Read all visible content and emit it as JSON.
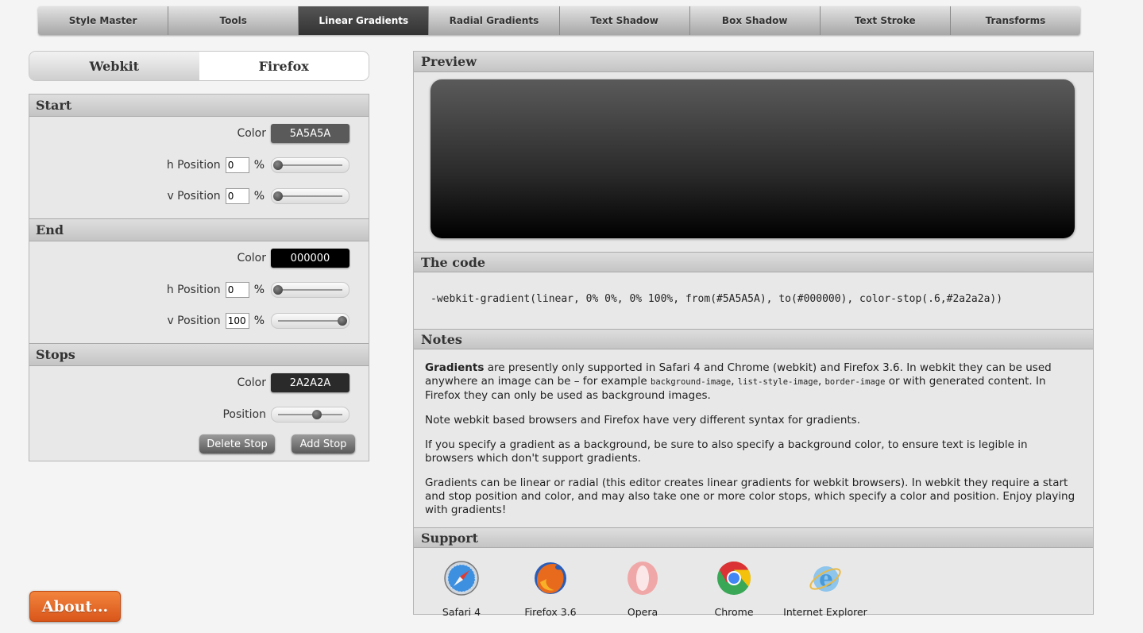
{
  "nav": {
    "tabs": [
      {
        "label": "Style Master",
        "active": false
      },
      {
        "label": "Tools",
        "active": false
      },
      {
        "label": "Linear Gradients",
        "active": true
      },
      {
        "label": "Radial Gradients",
        "active": false
      },
      {
        "label": "Text Shadow",
        "active": false
      },
      {
        "label": "Box Shadow",
        "active": false
      },
      {
        "label": "Text Stroke",
        "active": false
      },
      {
        "label": "Transforms",
        "active": false
      }
    ]
  },
  "browser_toggle": {
    "webkit": "Webkit",
    "firefox": "Firefox",
    "selected": "Firefox"
  },
  "start": {
    "title": "Start",
    "color_label": "Color",
    "color_value": "5A5A5A",
    "color_hex": "#5A5A5A",
    "h_label": "h Position",
    "h_value": "0",
    "h_unit": "%",
    "h_percent": 0,
    "v_label": "v Position",
    "v_value": "0",
    "v_unit": "%",
    "v_percent": 0
  },
  "end": {
    "title": "End",
    "color_label": "Color",
    "color_value": "000000",
    "color_hex": "#000000",
    "h_label": "h Position",
    "h_value": "0",
    "h_unit": "%",
    "h_percent": 0,
    "v_label": "v Position",
    "v_value": "100",
    "v_unit": "%",
    "v_percent": 100
  },
  "stops": {
    "title": "Stops",
    "color_label": "Color",
    "color_value": "2A2A2A",
    "color_hex": "#2A2A2A",
    "position_label": "Position",
    "position_percent": 60,
    "delete_label": "Delete Stop",
    "add_label": "Add Stop"
  },
  "about_label": "About...",
  "preview_title": "Preview",
  "code_title": "The code",
  "code_text": "-webkit-gradient(linear, 0% 0%, 0% 100%, from(#5A5A5A), to(#000000), color-stop(.6,#2a2a2a))",
  "notes": {
    "title": "Notes",
    "p1_bold": "Gradients",
    "p1_a": " are presently only supported in Safari 4 and Chrome (webkit) and Firefox 3.6. In webkit they can be used anywhere an image can be – for example ",
    "p1_code1": "background-image",
    "p1_sep1": ", ",
    "p1_code2": "list-style-image",
    "p1_sep2": ", ",
    "p1_code3": "border-image",
    "p1_b": " or with generated content. In Firefox they can only be used as background images.",
    "p2": "Note webkit based browsers and Firefox have very different syntax for gradients.",
    "p3": "If you specify a gradient as a background, be sure to also specify a background color, to ensure text is legible in browsers which don't support gradients.",
    "p4": "Gradients can be linear or radial (this editor creates linear gradients for webkit browsers). In webkit they require a start and stop position and color, and may also take one or more color stops, which specify a color and position. Enjoy playing with gradients!"
  },
  "support": {
    "title": "Support",
    "browsers": [
      {
        "label": "Safari 4",
        "icon": "safari-icon"
      },
      {
        "label": "Firefox 3.6",
        "icon": "firefox-icon"
      },
      {
        "label": "Opera",
        "icon": "opera-icon"
      },
      {
        "label": "Chrome",
        "icon": "chrome-icon"
      },
      {
        "label": "Internet Explorer",
        "icon": "internet-explorer-icon"
      }
    ]
  }
}
